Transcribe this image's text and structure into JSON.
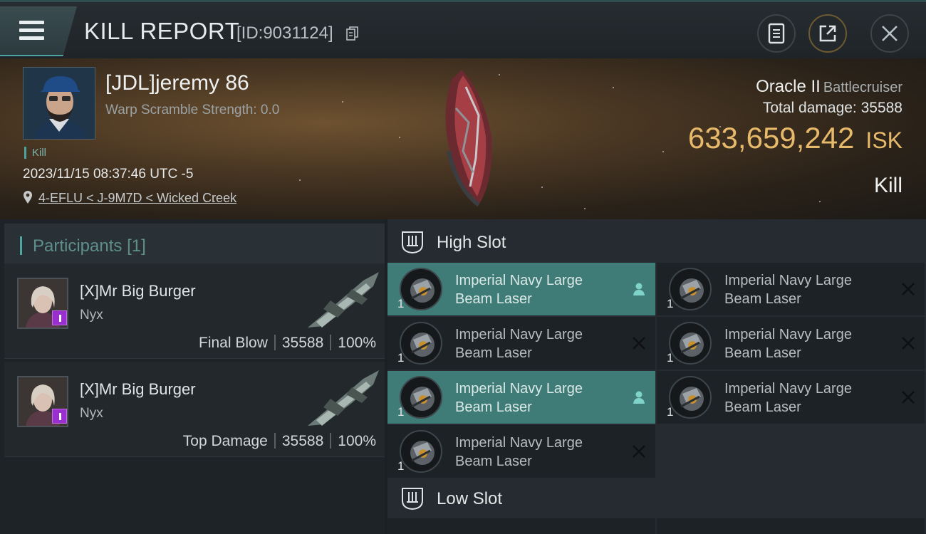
{
  "header": {
    "title": "KILL REPORT",
    "report_id": "[ID:9031124]",
    "icons": [
      "menu-icon",
      "copy-icon",
      "document-icon",
      "share-icon",
      "close-icon"
    ]
  },
  "victim": {
    "name": "[JDL]jeremy 86",
    "warp_scramble": "Warp Scramble Strength: 0.0",
    "kill_tag": "Kill",
    "datetime": "2023/11/15 08:37:46 UTC -5",
    "location": "4-EFLU < J-9M7D < Wicked Creek",
    "ship_name": "Oracle II",
    "ship_class": "Battlecruiser",
    "total_damage": "Total damage:  35588",
    "isk_value": "633,659,242",
    "isk_unit": "ISK",
    "result": "Kill"
  },
  "participants": {
    "title": "Participants",
    "count": "[1]",
    "cards": [
      {
        "name": "[X]Mr Big Burger",
        "ship": "Nyx",
        "role": "Final Blow",
        "damage": "35588",
        "percent": "100%"
      },
      {
        "name": "[X]Mr Big Burger",
        "ship": "Nyx",
        "role": "Top Damage",
        "damage": "35588",
        "percent": "100%"
      }
    ]
  },
  "fitting": {
    "high_slot_title": "High Slot",
    "low_slot_title": "Low Slot",
    "module_name_line1": "Imperial Navy Large",
    "module_name_line2": "Beam Laser",
    "module_count": "1",
    "high_modules": [
      {
        "state": "active",
        "action": "pilot-icon"
      },
      {
        "state": "destroyed",
        "action": "x-icon"
      },
      {
        "state": "destroyed",
        "action": "x-icon"
      },
      {
        "state": "destroyed",
        "action": "x-icon"
      },
      {
        "state": "active",
        "action": "pilot-icon"
      },
      {
        "state": "destroyed",
        "action": "x-icon"
      },
      {
        "state": "destroyed",
        "action": "x-icon"
      }
    ]
  },
  "colors": {
    "accent_teal": "#4ea59d",
    "isk_gold": "#e7b96a",
    "active_module": "#3f7c78"
  }
}
